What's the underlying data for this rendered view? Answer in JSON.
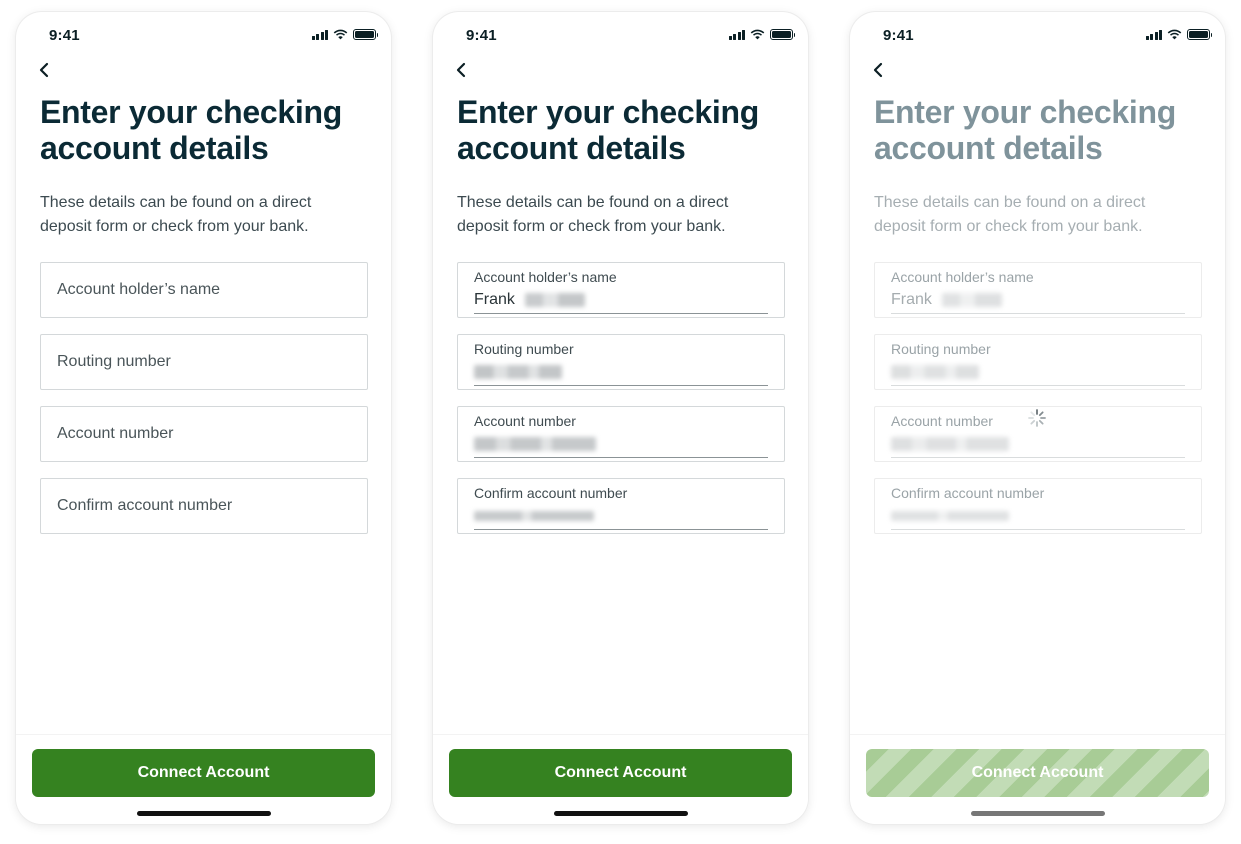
{
  "status": {
    "time": "9:41"
  },
  "colors": {
    "primary": "#358220",
    "heading": "#0b2a35",
    "disabled_stripe_a": "#a8cc96",
    "disabled_stripe_b": "#c2dcb6"
  },
  "icons": {
    "back": "chevron-left-icon",
    "signal": "signal-icon",
    "wifi": "wifi-icon",
    "battery": "battery-icon",
    "loading": "spinner-icon"
  },
  "screens": [
    {
      "state": "empty",
      "title": "Enter your checking account details",
      "subtitle": "These details can be found on a direct deposit form or check from your bank.",
      "fields": [
        {
          "placeholder": "Account holder’s name"
        },
        {
          "placeholder": "Routing number"
        },
        {
          "placeholder": "Account number"
        },
        {
          "placeholder": "Confirm account number"
        }
      ],
      "cta_label": "Connect Account"
    },
    {
      "state": "filled",
      "title": "Enter your checking account details",
      "subtitle": "These details can be found on a direct deposit form or check from your bank.",
      "fields": [
        {
          "label": "Account holder’s name",
          "value": "Frank",
          "value_obscured": true
        },
        {
          "label": "Routing number",
          "value_obscured": true
        },
        {
          "label": "Account number",
          "value_obscured": true
        },
        {
          "label": "Confirm account number",
          "value_obscured": true
        }
      ],
      "cta_label": "Connect Account"
    },
    {
      "state": "loading",
      "title": "Enter your checking account details",
      "subtitle": "These details can be found on a direct deposit form or check from your bank.",
      "fields": [
        {
          "label": "Account holder’s name",
          "value": "Frank",
          "value_obscured": true
        },
        {
          "label": "Routing number",
          "value_obscured": true
        },
        {
          "label": "Account number",
          "value_obscured": true
        },
        {
          "label": "Confirm account number",
          "value_obscured": true
        }
      ],
      "cta_label": "Connect Account",
      "cta_disabled": true
    }
  ]
}
